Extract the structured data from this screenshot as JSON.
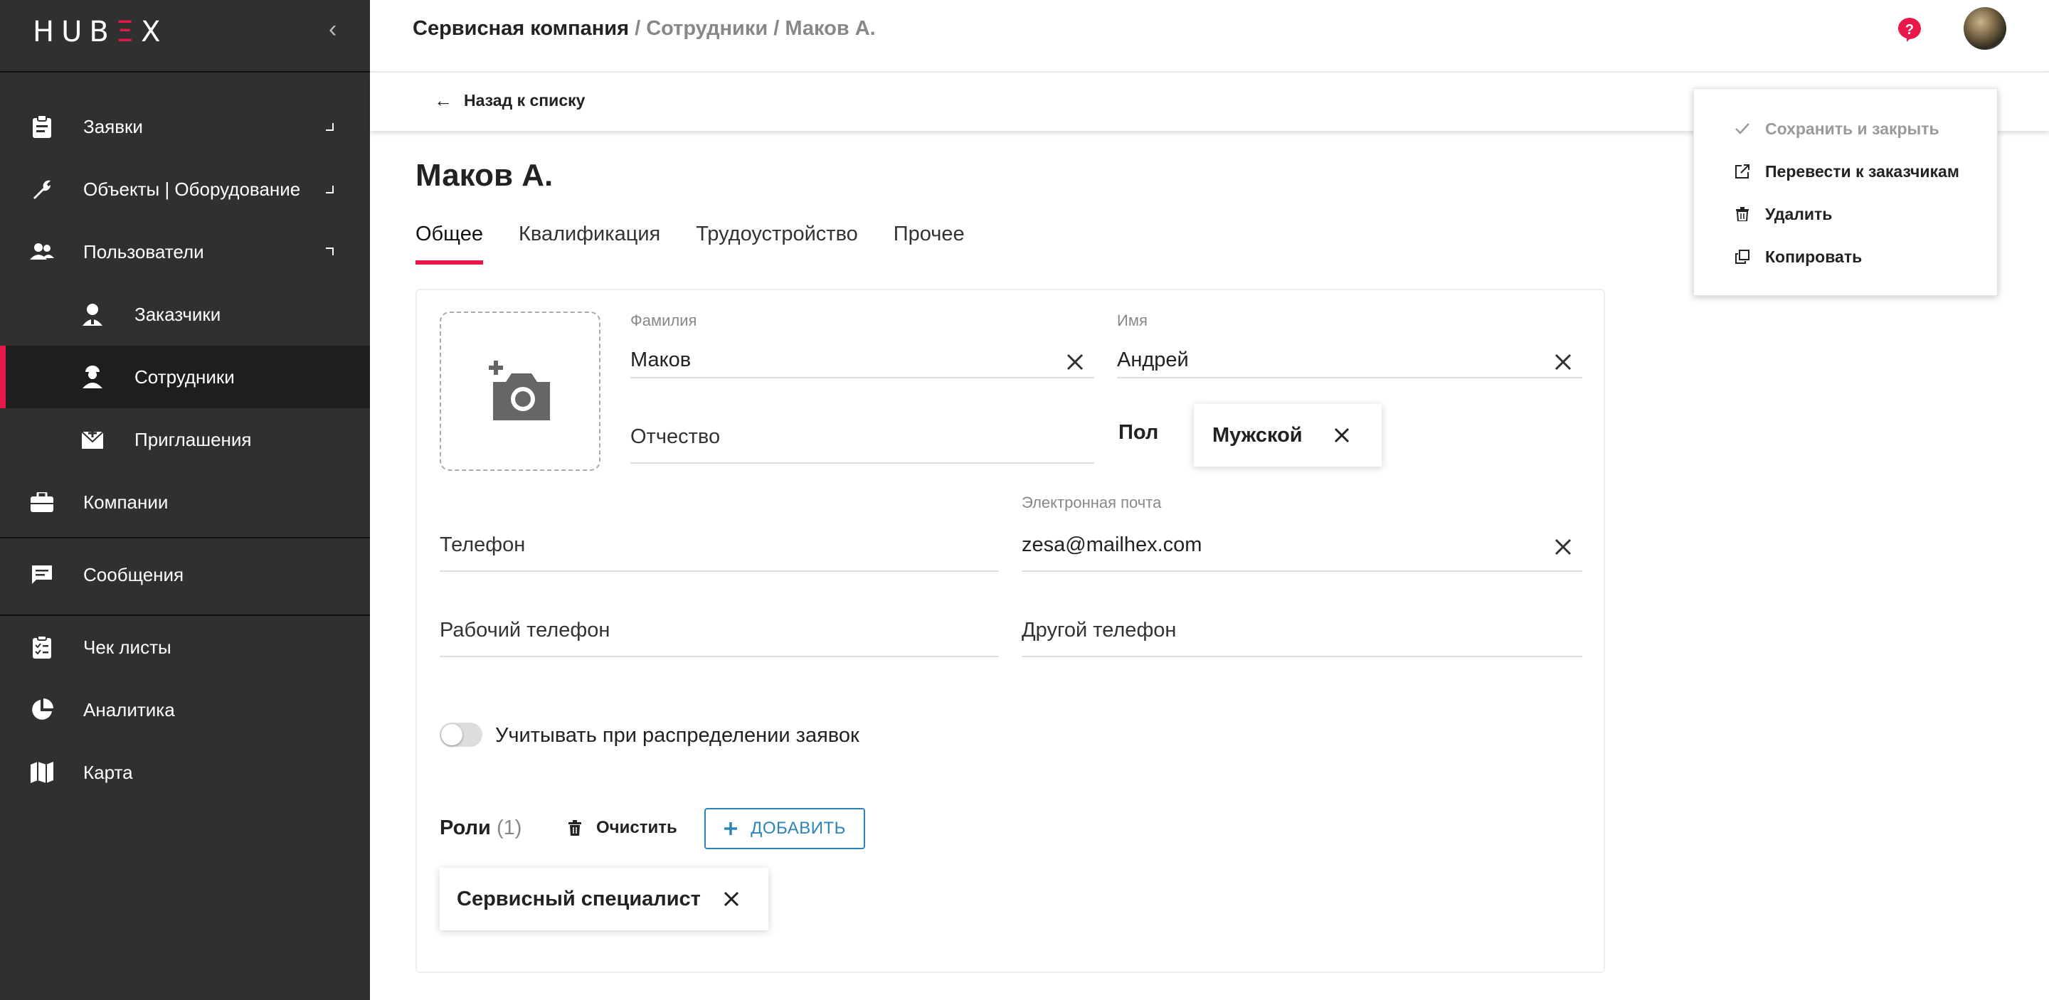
{
  "sidebar": {
    "logo": {
      "part1": "HUB",
      "accent": "Ξ",
      "part2": "X"
    },
    "items": [
      {
        "label": "Заявки",
        "icon": "clipboard-icon"
      },
      {
        "label": "Объекты | Оборудование",
        "icon": "wrench-icon"
      },
      {
        "label": "Пользователи",
        "icon": "users-icon"
      },
      {
        "label": "Заказчики",
        "icon": "customer-icon"
      },
      {
        "label": "Сотрудники",
        "icon": "worker-icon"
      },
      {
        "label": "Приглашения",
        "icon": "invite-icon"
      },
      {
        "label": "Компании",
        "icon": "briefcase-icon"
      },
      {
        "label": "Сообщения",
        "icon": "message-icon"
      },
      {
        "label": "Чек листы",
        "icon": "checklist-icon"
      },
      {
        "label": "Аналитика",
        "icon": "piechart-icon"
      },
      {
        "label": "Карта",
        "icon": "map-icon"
      }
    ]
  },
  "header": {
    "breadcrumb": {
      "root": "Сервисная компания",
      "sep": " / ",
      "section": "Сотрудники",
      "current": "Маков А."
    },
    "back_label": "Назад к списку"
  },
  "page": {
    "title": "Маков А.",
    "tabs": [
      "Общее",
      "Квалификация",
      "Трудоустройство",
      "Прочее"
    ]
  },
  "form": {
    "last_name": {
      "label": "Фамилия",
      "value": "Маков"
    },
    "first_name": {
      "label": "Имя",
      "value": "Андрей"
    },
    "middle_name": {
      "placeholder": "Отчество"
    },
    "gender": {
      "label": "Пол",
      "value": "Мужской"
    },
    "phone": {
      "placeholder": "Телефон"
    },
    "email": {
      "label": "Электронная почта",
      "value": "zesa@mailhex.com"
    },
    "work_phone": {
      "placeholder": "Рабочий телефон"
    },
    "other_phone": {
      "placeholder": "Другой телефон"
    },
    "distribution_toggle": {
      "label": "Учитывать при распределении заявок",
      "on": false
    },
    "roles": {
      "title": "Роли",
      "count": "(1)",
      "clear_label": "Очистить",
      "add_label": "ДОБАВИТЬ",
      "items": [
        "Сервисный специалист"
      ]
    }
  },
  "menu": {
    "items": [
      {
        "label": "Сохранить и закрыть",
        "icon": "check-icon",
        "disabled": true
      },
      {
        "label": "Перевести к заказчикам",
        "icon": "external-link-icon",
        "disabled": false
      },
      {
        "label": "Удалить",
        "icon": "trash-icon",
        "disabled": false
      },
      {
        "label": "Копировать",
        "icon": "copy-icon",
        "disabled": false
      }
    ]
  },
  "colors": {
    "accent": "#e8194a",
    "sidebar_bg": "#303030",
    "link_blue": "#2a86b8"
  }
}
